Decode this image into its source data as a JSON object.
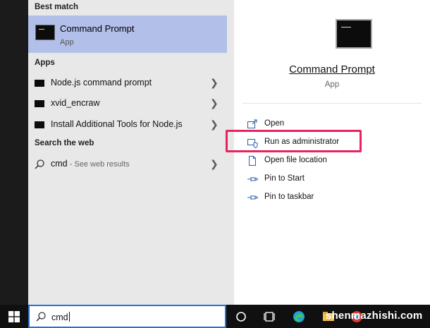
{
  "left_panel": {
    "best_match_header": "Best match",
    "best_match": {
      "name": "Command Prompt",
      "type": "App",
      "icon": "terminal-icon"
    },
    "apps_header": "Apps",
    "apps": [
      {
        "label": "Node.js command prompt",
        "icon": "terminal-icon"
      },
      {
        "label": "xvid_encraw",
        "icon": "terminal-icon"
      },
      {
        "label": "Install Additional Tools for Node.js",
        "icon": "terminal-icon"
      }
    ],
    "web_header": "Search the web",
    "web_result": {
      "query": "cmd",
      "sub": " - See web results",
      "icon": "search-icon"
    }
  },
  "right_panel": {
    "title": "Command Prompt",
    "subtitle": "App",
    "actions": [
      {
        "label": "Open",
        "icon": "open-icon"
      },
      {
        "label": "Run as administrator",
        "icon": "shield-icon"
      },
      {
        "label": "Open file location",
        "icon": "file-location-icon"
      },
      {
        "label": "Pin to Start",
        "icon": "pin-icon"
      },
      {
        "label": "Pin to taskbar",
        "icon": "pin-icon"
      }
    ]
  },
  "taskbar": {
    "search_value": "cmd",
    "watermark": "shenmazhishi.com"
  },
  "colors": {
    "selection": "#b2bfe8",
    "highlight_border": "#e8225e",
    "search_border": "#2b6fd6"
  }
}
